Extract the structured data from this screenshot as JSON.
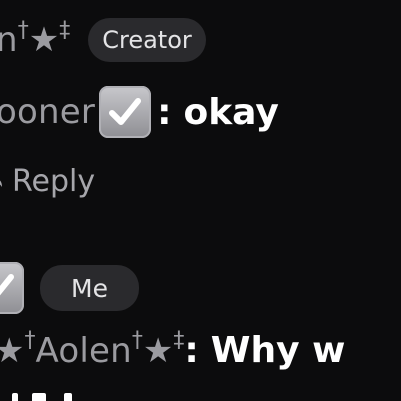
{
  "comment1": {
    "author_fragment": "n",
    "dagger": "†",
    "double_dagger": "‡",
    "star": "★",
    "badge": "Creator",
    "sub_author_fragment": "ooner",
    "colon": ":",
    "message": "okay",
    "reply_label": "Reply"
  },
  "comment2": {
    "badge": "Me",
    "author_name": "Aolen",
    "dagger": "†",
    "double_dagger": "‡",
    "star": "★",
    "colon": ":",
    "message_fragment": "Why w"
  },
  "colors": {
    "background": "#0c0c0d",
    "badge_bg": "#2a2a2d",
    "muted_text": "#9b9ba0",
    "message_text": "#ffffff"
  },
  "icons": [
    "checkmark-icon",
    "reply-arrow-icon"
  ]
}
